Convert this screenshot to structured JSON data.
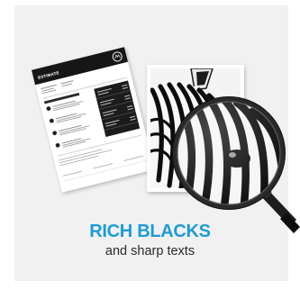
{
  "headline": "RICH BLACKS",
  "subline": "and sharp texts",
  "document": {
    "title": "ESTIMATE"
  },
  "colors": {
    "accent": "#1e9bd7",
    "text": "#2b2b2b",
    "panel": "#f1f1f1"
  },
  "icons": [
    "zebra-photo",
    "magnifying-glass-icon",
    "document-logo-icon"
  ]
}
